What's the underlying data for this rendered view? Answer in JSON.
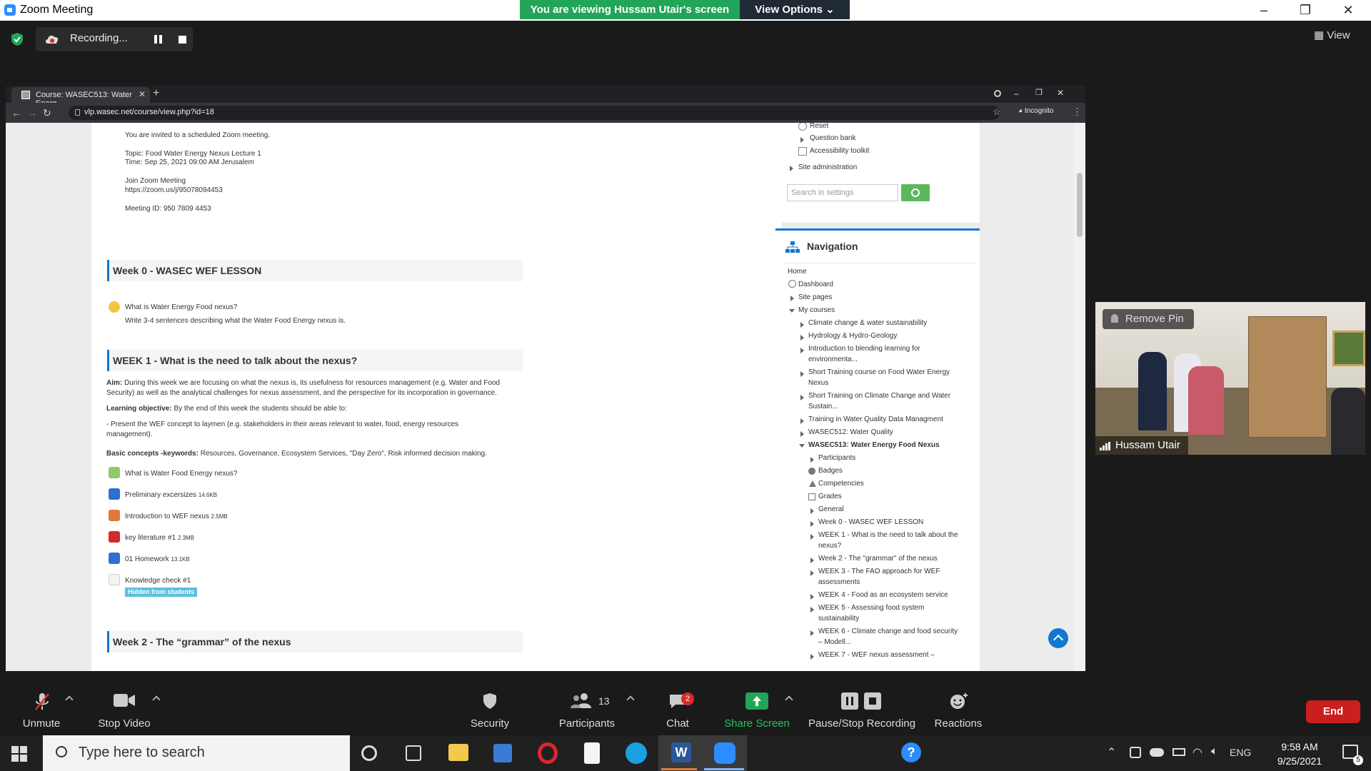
{
  "window": {
    "title": "Zoom Meeting",
    "minimize": "–",
    "maximize": "❐",
    "close": "✕"
  },
  "banner": {
    "viewing": "You are viewing Hussam Utair's screen",
    "view_options": "View Options ⌄"
  },
  "recording": {
    "status": "Recording..."
  },
  "view_button": "View",
  "browser": {
    "tab_title": "Course: WASEC513: Water Energ",
    "tab_close": "✕",
    "new_tab": "+",
    "url": "vlp.wasec.net/course/view.php?id=18",
    "incognito": "Incognito"
  },
  "course": {
    "invite_lines": [
      "You are invited to a scheduled Zoom meeting.",
      "Topic: Food Water Energy Nexus Lecture 1",
      "Time: Sep 25, 2021 09:00 AM Jerusalem",
      "Join Zoom Meeting",
      "https://zoom.us/j/95078094453",
      "Meeting ID: 950 7809 4453"
    ],
    "week0": {
      "title": "Week 0 - WASEC WEF LESSON",
      "forum": "What is Water Energy Food nexus?",
      "desc": "Write 3-4 sentences describing what the Water Food Energy nexus is."
    },
    "week1": {
      "title": "WEEK 1 - What is the need to talk about the nexus?",
      "aim_label": "Aim:",
      "aim_text1": "During this week we are focusing on what the nexus is, its usefulness for resources management (e.g. Water and Food",
      "aim_text2": "Security) as well as the analytical challenges for nexus assessment, and the perspective for its incorporation in governance.",
      "lo_label": "Learning objective:",
      "lo_text": "By the end of this week the students should be able to:",
      "bullet1": "- Present the WEF concept to laymen (e.g. stakeholders in their areas relevant to water, food, energy resources",
      "bullet2": "management).",
      "kw_label": "Basic concepts -keywords:",
      "kw_text": "Resources, Governance, Ecosystem Services, \"Day Zero\", Risk informed decision making.",
      "activities": [
        {
          "name": "What is Water Food Energy nexus?",
          "size": ""
        },
        {
          "name": "Preliminary excersizes",
          "size": "14.6KB"
        },
        {
          "name": "Introduction to WEF nexus",
          "size": "2.5MB"
        },
        {
          "name": "key literature #1",
          "size": "2.3MB"
        },
        {
          "name": "01 Homework",
          "size": "13.1KB"
        },
        {
          "name": "Knowledge check #1",
          "size": ""
        }
      ],
      "hidden_badge": "Hidden from students"
    },
    "week2": {
      "title": "Week 2 - The “grammar” of the nexus"
    }
  },
  "settings": {
    "items": [
      "Reset",
      "Question bank",
      "Accessibility toolkit"
    ],
    "site_admin": "Site administration",
    "search_placeholder": "Search in settings"
  },
  "navigation": {
    "title": "Navigation",
    "home": "Home",
    "dashboard": "Dashboard",
    "site_pages": "Site pages",
    "my_courses": "My courses",
    "courses": [
      "Climate change & water sustainability",
      "Hydrology & Hydro-Geology",
      "Introduction to blending learning for",
      "environmenta...",
      "Short Training course on Food Water Energy",
      "Nexus",
      "Short Training on Climate Change and Water",
      "Sustain...",
      "Training in Water Quality Data Managment",
      "WASEC512: Water Quality",
      "WASEC513: Water Energy Food Nexus"
    ],
    "sub": [
      "Participants",
      "Badges",
      "Competencies",
      "Grades",
      "General",
      "Week 0 - WASEC WEF LESSON",
      "WEEK 1 - What is the need to talk about the",
      "nexus?",
      "Week 2 - The \"grammar\" of the nexus",
      "WEEK 3 - The FAO approach for WEF",
      "assessments",
      "WEEK 4 - Food as an ecosystem service",
      "WEEK 5 - Assessing food system",
      "sustainability",
      "WEEK 6 - Climate change and food security",
      "– Modell...",
      "WEEK 7 - WEF nexus assessment –"
    ]
  },
  "video": {
    "remove_pin": "Remove Pin",
    "participant_name": "Hussam Utair"
  },
  "toolbar": {
    "unmute": "Unmute",
    "stop_video": "Stop Video",
    "security": "Security",
    "participants": "Participants",
    "participants_count": "13",
    "chat": "Chat",
    "chat_badge": "2",
    "share_screen": "Share Screen",
    "pause_stop": "Pause/Stop Recording",
    "reactions": "Reactions",
    "end": "End"
  },
  "taskbar": {
    "search_placeholder": "Type here to search",
    "lang": "ENG",
    "time": "9:58 AM",
    "date": "9/25/2021",
    "notifications": "5"
  },
  "colors": {
    "accent": "#1177d1",
    "share_green": "#23a559",
    "end_red": "#c9201f"
  }
}
